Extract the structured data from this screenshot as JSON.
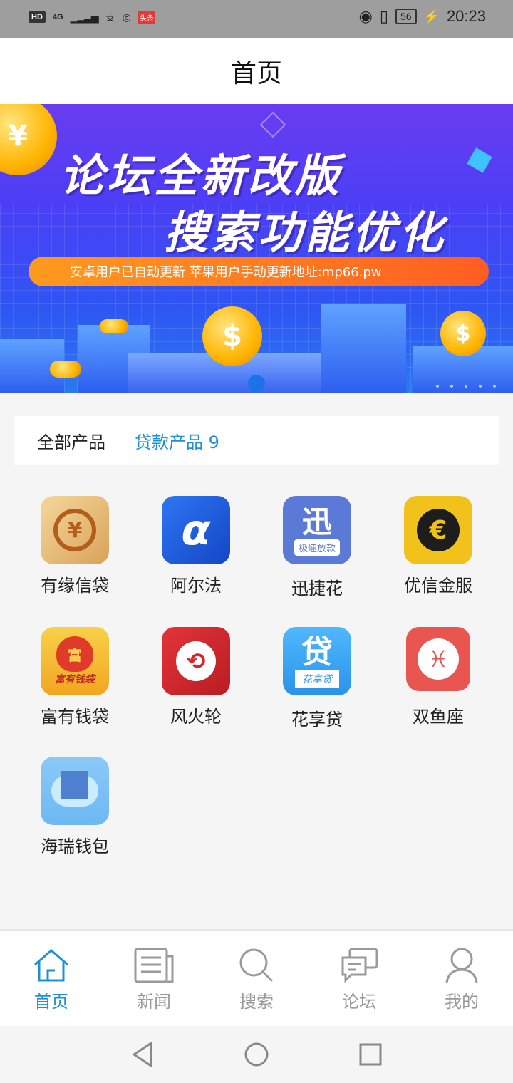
{
  "status_bar": {
    "hd": "HD",
    "network": "4G",
    "time": "20:23",
    "battery": "56"
  },
  "header": {
    "title": "首页"
  },
  "banner": {
    "line1": "论坛全新改版",
    "line2": "搜索功能优化",
    "strip_text": "安卓用户已自动更新   苹果用户手动更新地址:mp66.pw",
    "accent": "#ff7a1e"
  },
  "filter_tabs": {
    "all": "全部产品",
    "loan": "贷款产品 9",
    "active_color": "#1e90d6"
  },
  "apps": [
    {
      "label": "有缘信袋",
      "icon": "yuan-coin-icon",
      "glyph": "¥",
      "color": "#e7b46c"
    },
    {
      "label": "阿尔法",
      "icon": "alpha-icon",
      "glyph": "α",
      "color": "#1f5fe0"
    },
    {
      "label": "迅捷花",
      "icon": "xun-icon",
      "glyph": "迅",
      "sub": "极速放款",
      "color": "#5b79d6"
    },
    {
      "label": "优信金服",
      "icon": "euro-icon",
      "glyph": "€",
      "color": "#f1c21b"
    },
    {
      "label": "富有钱袋",
      "icon": "money-bag-icon",
      "glyph": "富",
      "sub": "富有钱袋",
      "color": "#f5b93a"
    },
    {
      "label": "风火轮",
      "icon": "fire-wheel-icon",
      "glyph": "⟲",
      "color": "#d6262c"
    },
    {
      "label": "花享贷",
      "icon": "dai-icon",
      "glyph": "贷",
      "sub": "花享贷",
      "color": "#3aa7f5"
    },
    {
      "label": "双鱼座",
      "icon": "pisces-icon",
      "glyph": "♓",
      "color": "#e8564f"
    },
    {
      "label": "海瑞钱包",
      "icon": "city-cloud-icon",
      "glyph": "▦",
      "color": "#7bc3f6"
    }
  ],
  "tab_bar": {
    "items": [
      {
        "label": "首页",
        "icon": "home-icon",
        "active": true
      },
      {
        "label": "新闻",
        "icon": "news-icon"
      },
      {
        "label": "搜索",
        "icon": "search-icon"
      },
      {
        "label": "论坛",
        "icon": "forum-icon"
      },
      {
        "label": "我的",
        "icon": "profile-icon"
      }
    ],
    "active_color": "#1e90d6",
    "inactive_color": "#9a9a9a"
  }
}
